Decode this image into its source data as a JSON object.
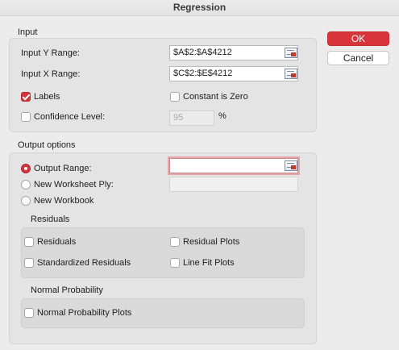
{
  "window": {
    "title": "Regression"
  },
  "buttons": {
    "ok_label": "OK",
    "cancel_label": "Cancel"
  },
  "input_section": {
    "title": "Input",
    "y_range_label": "Input Y Range:",
    "y_range_value": "$A$2:$A$4212",
    "x_range_label": "Input X Range:",
    "x_range_value": "$C$2:$E$4212",
    "labels_label": "Labels",
    "labels_checked": true,
    "constant_zero_label": "Constant is Zero",
    "constant_zero_checked": false,
    "confidence_label": "Confidence Level:",
    "confidence_checked": false,
    "confidence_value": "95",
    "confidence_unit": "%"
  },
  "output_section": {
    "title": "Output options",
    "output_range_label": "Output Range:",
    "output_range_value": "",
    "new_ply_label": "New Worksheet Ply:",
    "new_ply_value": "",
    "new_workbook_label": "New Workbook",
    "selected_option": "Output Range"
  },
  "residuals": {
    "title": "Residuals",
    "residuals_label": "Residuals",
    "residual_plots_label": "Residual Plots",
    "standardized_label": "Standardized Residuals",
    "line_fit_label": "Line Fit Plots"
  },
  "normal_probability": {
    "title": "Normal Probability",
    "plots_label": "Normal Probability Plots"
  },
  "colors": {
    "accent": "#d7353b",
    "dialog_bg": "#ececec",
    "group_bg": "#e4e4e4"
  },
  "icons": {
    "range_selector": "range-selector-icon"
  }
}
